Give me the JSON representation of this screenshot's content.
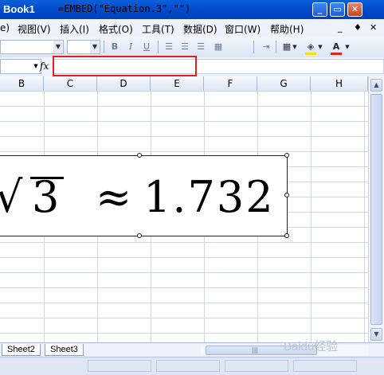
{
  "window": {
    "title": "Book1",
    "controls": {
      "minimize": "_",
      "restore": "▭",
      "close": "✕"
    }
  },
  "menu": {
    "items": [
      "e)",
      "视图(V)",
      "插入(I)",
      "格式(O)",
      "工具(T)",
      "数据(D)",
      "窗口(W)",
      "帮助(H)"
    ],
    "right_controls": [
      "_",
      "♦",
      "✕"
    ]
  },
  "toolbar": {
    "icons": [
      "bold-icon",
      "italic-icon",
      "underline-icon",
      "align-left-icon",
      "align-center-icon",
      "align-right-icon",
      "merge-center-icon",
      "indent-icon",
      "borders-icon",
      "fill-color-icon",
      "font-color-icon"
    ],
    "bold": "B",
    "italic": "I",
    "underline": "U",
    "font_color_letter": "A",
    "colors": {
      "fill": "#f6e20a",
      "font": "#e3241c"
    }
  },
  "formula_bar": {
    "fx_label": "fx",
    "formula": "=EMBED(\"Equation.3\",\"\")"
  },
  "columns": [
    "B",
    "C",
    "D",
    "E",
    "F",
    "G",
    "H"
  ],
  "equation": {
    "radical": "√",
    "radicand": "3",
    "approx": "≈",
    "value": "1.732"
  },
  "sheets": {
    "tabs": [
      "Sheet2",
      "Sheet3"
    ]
  },
  "watermark": "Baidu经验",
  "colors": {
    "title_bar": "#0048c8",
    "highlight_box": "#e0211d"
  }
}
